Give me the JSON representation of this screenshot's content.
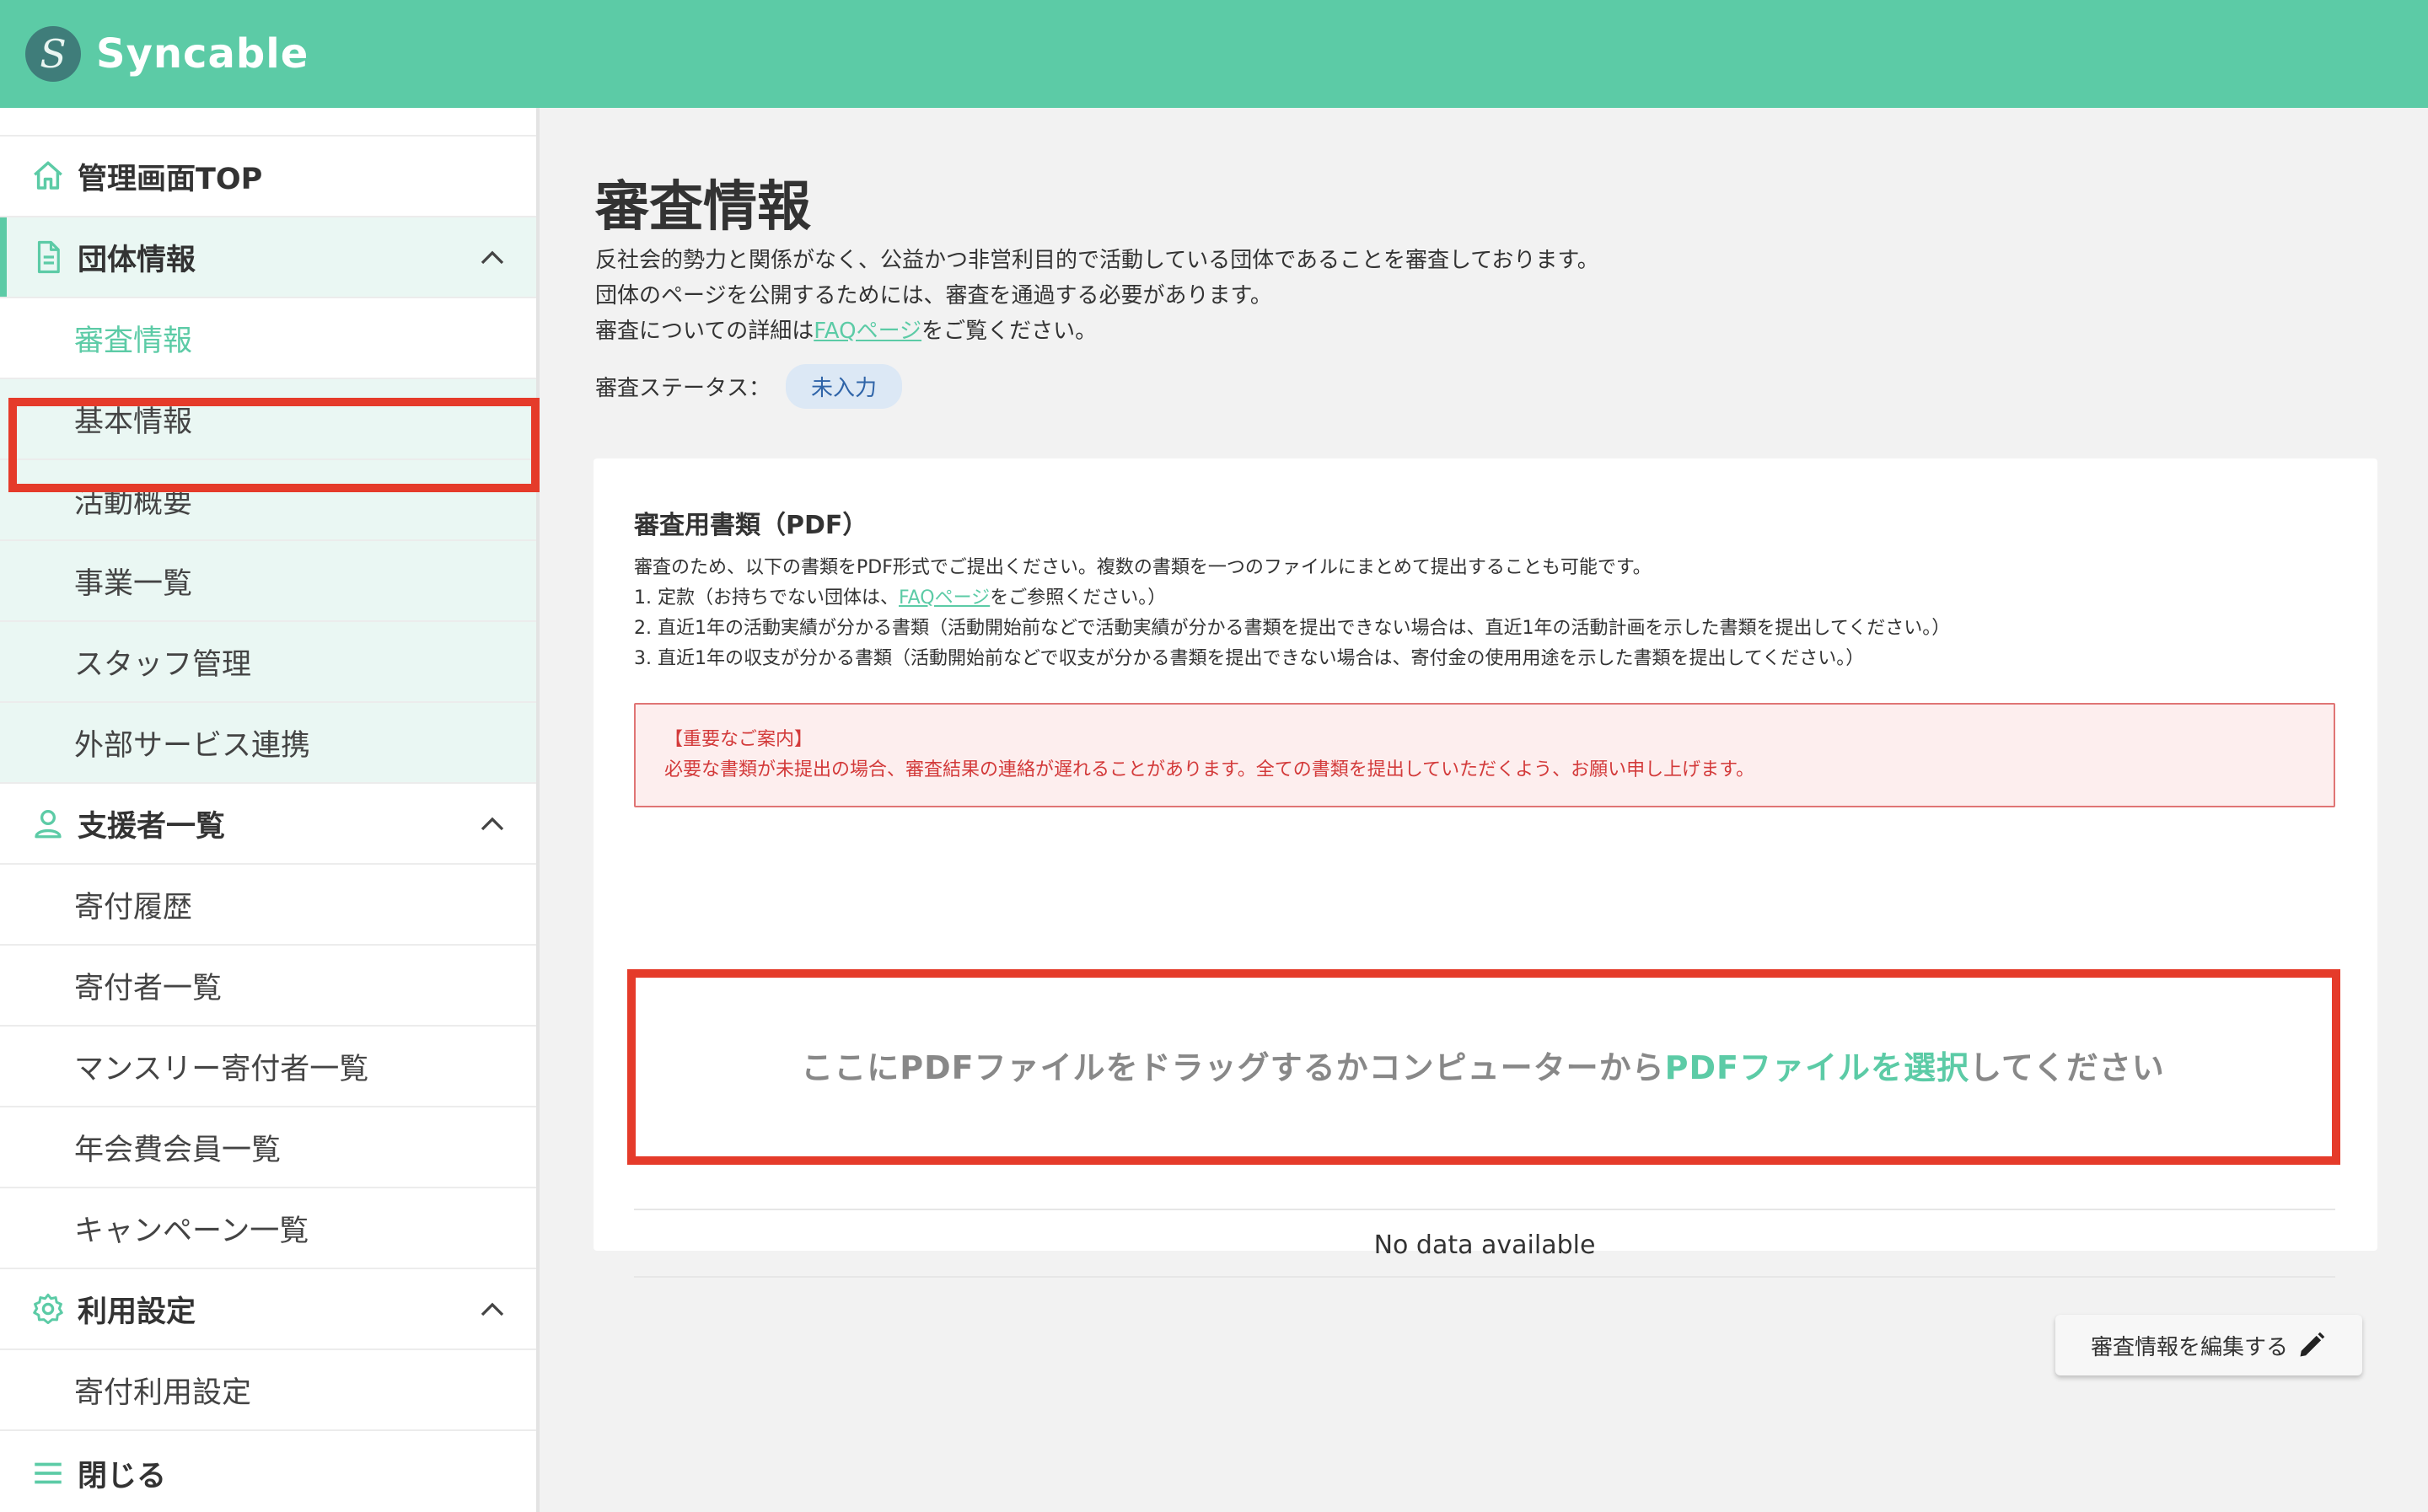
{
  "header": {
    "logo_letter": "S",
    "app_name": "Syncable",
    "color": "#5ccba6"
  },
  "sidebar": {
    "top": {
      "label": "管理画面TOP",
      "icon": "home-icon"
    },
    "groups": [
      {
        "label": "団体情報",
        "icon": "document-icon",
        "items": [
          "審査情報",
          "基本情報",
          "活動概要",
          "事業一覧",
          "スタッフ管理",
          "外部サービス連携"
        ],
        "selected": "審査情報"
      },
      {
        "label": "支援者一覧",
        "icon": "person-icon",
        "items": [
          "寄付履歴",
          "寄付者一覧",
          "マンスリー寄付者一覧",
          "年会費会員一覧",
          "キャンペーン一覧"
        ]
      },
      {
        "label": "利用設定",
        "icon": "gear-icon",
        "items": [
          "寄付利用設定"
        ]
      }
    ],
    "close": {
      "label": "閉じる",
      "icon": "menu-icon"
    }
  },
  "main": {
    "title": "審査情報",
    "desc_line1": "反社会的勢力と関係がなく、公益かつ非営利目的で活動している団体であることを審査しております。",
    "desc_line2": "団体のページを公開するためには、審査を通過する必要があります。",
    "desc_line3_pre": "審査についての詳細は",
    "desc_line3_link": "FAQページ",
    "desc_line3_post": "をご覧ください。",
    "status_label": "審査ステータス：",
    "status_value": "未入力"
  },
  "card": {
    "title": "審査用書類（PDF）",
    "intro": "審査のため、以下の書類をPDF形式でご提出ください。複数の書類を一つのファイルにまとめて提出することも可能です。",
    "item1_pre": "1. 定款（お持ちでない団体は、",
    "item1_link": "FAQページ",
    "item1_post": "をご参照ください。）",
    "item2": "2. 直近1年の活動実績が分かる書類（活動開始前などで活動実績が分かる書類を提出できない場合は、直近1年の活動計画を示した書類を提出してください。）",
    "item3": "3. 直近1年の収支が分かる書類（活動開始前などで収支が分かる書類を提出できない場合は、寄付金の使用用途を示した書類を提出してください。）",
    "notice_title": "【重要なご案内】",
    "notice_body": "必要な書類が未提出の場合、審査結果の連絡が遅れることがあります。全ての書類を提出していただくよう、お願い申し上げます。",
    "drop_pre": "ここにPDFファイルをドラッグするかコンピューターから",
    "drop_link": "PDFファイルを選択",
    "drop_post": "してください",
    "no_data": "No data available"
  },
  "edit_button": {
    "label": "審査情報を編集する",
    "icon": "pencil-icon"
  },
  "colors": {
    "accent": "#5ccba6",
    "highlight": "#e53b2a",
    "notice": "#d33a3a",
    "badge": "#dce8f5"
  }
}
